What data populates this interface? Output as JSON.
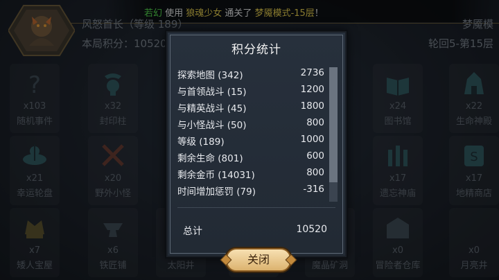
{
  "banner": {
    "player": "若幻",
    "text1": " 使用 ",
    "hero": "狼魂少女",
    "text2": " 通关了 ",
    "mode": "梦魇模式-15层",
    "text3": "！"
  },
  "hero_info": {
    "name": "风怒首长（等级 189）",
    "score": "本局积分：10520",
    "mode": "梦魇模",
    "round": "轮回5-第15层"
  },
  "tiles": [
    {
      "name": "随机事件",
      "count": "x103",
      "icon": "question-icon"
    },
    {
      "name": "封印柱",
      "count": "x32",
      "icon": "seal-pillar-icon"
    },
    {
      "name": "图书馆",
      "count": "x24",
      "icon": "book-icon"
    },
    {
      "name": "生命神殿",
      "count": "x22",
      "icon": "temple-icon"
    },
    {
      "name": "幸运轮盘",
      "count": "x21",
      "icon": "wheel-icon"
    },
    {
      "name": "野外小怪",
      "count": "x20",
      "icon": "swords-icon"
    },
    {
      "name": "遗忘神庙",
      "count": "x17",
      "icon": "shrine-icon"
    },
    {
      "name": "地精商店",
      "count": "x17",
      "icon": "shop-icon"
    },
    {
      "name": "矮人宝屋",
      "count": "x7",
      "icon": "treasure-icon"
    },
    {
      "name": "铁匠铺",
      "count": "x6",
      "icon": "anvil-icon"
    },
    {
      "name": "太阳井",
      "count": "",
      "icon": "sun-well-icon"
    },
    {
      "name": "勇士之墓",
      "count": "",
      "icon": "tomb-icon"
    },
    {
      "name": "魔晶矿洞",
      "count": "",
      "icon": "mine-icon"
    },
    {
      "name": "冒险者仓库",
      "count": "x0",
      "icon": "warehouse-icon"
    },
    {
      "name": "月亮井",
      "count": "x0",
      "icon": "moon-well-icon"
    }
  ],
  "modal": {
    "title": "积分统计",
    "rows": [
      {
        "label": "探索地图 (342)",
        "value": "2736"
      },
      {
        "label": "与首领战斗 (15)",
        "value": "1200"
      },
      {
        "label": "与精英战斗 (45)",
        "value": "1800"
      },
      {
        "label": "与小怪战斗 (50)",
        "value": "800"
      },
      {
        "label": "等级 (189)",
        "value": "1000"
      },
      {
        "label": "剩余生命 (801)",
        "value": "600"
      },
      {
        "label": "剩余金币 (14031)",
        "value": "800"
      },
      {
        "label": "时间增加惩罚 (79)",
        "value": "-316"
      }
    ],
    "total_label": "总计",
    "total_value": "10520",
    "close_label": "关闭"
  },
  "colors": {
    "accent": "#f1d64a",
    "player": "#55e04a",
    "button": "#e9c98a"
  }
}
